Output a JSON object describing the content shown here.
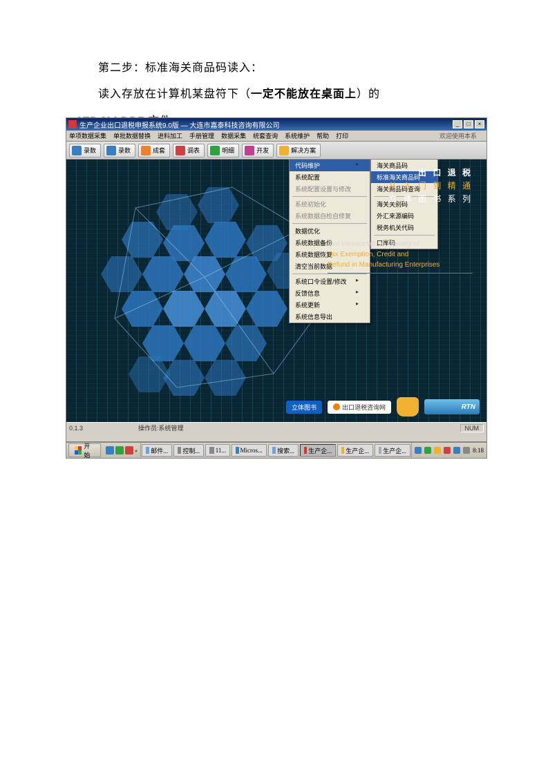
{
  "doc": {
    "p1": "第二步：标准海关商品码读入：",
    "p2a": "读入存放在计算机某盘符下（",
    "p2b": "一定不能放在桌面上",
    "p2c": "）的",
    "p3": "STDCM.DBF 文件"
  },
  "app": {
    "title": "生产企业出口退税申报系统9.0版 — 大连市嘉泰科技咨询有限公司",
    "welcome": "欢迎使用本系"
  },
  "menubar": [
    "单项数据采集",
    "单批数据替换",
    "进料加工",
    "手册管理",
    "数据采集",
    "统套查询",
    "系统维护",
    "帮助",
    "打印"
  ],
  "toolbar": [
    {
      "label": "录数",
      "color": "#3a7ec2"
    },
    {
      "label": "录数",
      "color": "#3a7ec2"
    },
    {
      "label": "成套",
      "color": "#f08030"
    },
    {
      "label": "调表",
      "color": "#d04040"
    },
    {
      "label": "明细",
      "color": "#30a040"
    },
    {
      "label": "开发",
      "color": "#c04090"
    },
    {
      "label": "解决方案",
      "color": "#f0b030"
    }
  ],
  "menu1": {
    "items": [
      {
        "label": "代码维护",
        "kind": "arrow"
      },
      {
        "label": "系统配置",
        "kind": "normal"
      },
      {
        "label": "系统配置设置与修改",
        "kind": "disabled"
      },
      {
        "label": "系统初始化",
        "kind": "disabled"
      },
      {
        "label": "系统数据自检自修复",
        "kind": "disabled"
      },
      {
        "label": "数据优化",
        "kind": "normal"
      },
      {
        "label": "系统数据备份",
        "kind": "normal"
      },
      {
        "label": "系统数据恢复",
        "kind": "normal"
      },
      {
        "label": "清空当前数据",
        "kind": "normal"
      },
      {
        "label": "系统口令设置/修改",
        "kind": "arrow"
      },
      {
        "label": "反馈信息",
        "kind": "arrow"
      },
      {
        "label": "系统更新",
        "kind": "arrow"
      },
      {
        "label": "系统信息导出",
        "kind": "normal"
      }
    ]
  },
  "menu2": {
    "items": [
      {
        "label": "海关商品码",
        "kind": "normal"
      },
      {
        "label": "标准海关商品码",
        "kind": "sel"
      },
      {
        "label": "海关商品码查询",
        "kind": "normal"
      },
      {
        "label": "海关关别码",
        "kind": "normal"
      },
      {
        "label": "外汇来源编码",
        "kind": "normal"
      },
      {
        "label": "税务机关代码",
        "kind": "normal"
      },
      {
        "label": "口岸码",
        "kind": "normal"
      }
    ]
  },
  "promo": {
    "l1": "出 口 退 税",
    "l2": "从 入 门 到 精 通",
    "l3": "立 体 图 书 系 列",
    "sub1": "rom Introduction to Mastery of",
    "sub2": "Tax Exemption, Credit and",
    "sub3": "Refund in Manufacturing Enterprises"
  },
  "badges": {
    "b1": "立体图书",
    "b2": "出口退税咨询网",
    "b3": "RTN"
  },
  "status": {
    "left": "0.1.3",
    "mid": "操作员:系统管理",
    "right": "NUM"
  },
  "taskbar": {
    "start": "开始",
    "tasks": [
      {
        "label": "邮件...",
        "color": "#6aa3de"
      },
      {
        "label": "控制...",
        "color": "#ddd"
      },
      {
        "label": "11...",
        "color": "#ddd"
      },
      {
        "label": "Micros...",
        "color": "#ddd"
      },
      {
        "label": "搜索...",
        "color": "#6aa3de"
      },
      {
        "label": "生产企...",
        "color": "#ddd",
        "active": true
      },
      {
        "label": "生产企...",
        "color": "#f0b030"
      },
      {
        "label": "生产企...",
        "color": "#d0d0d0"
      }
    ],
    "clock": "8:18"
  }
}
